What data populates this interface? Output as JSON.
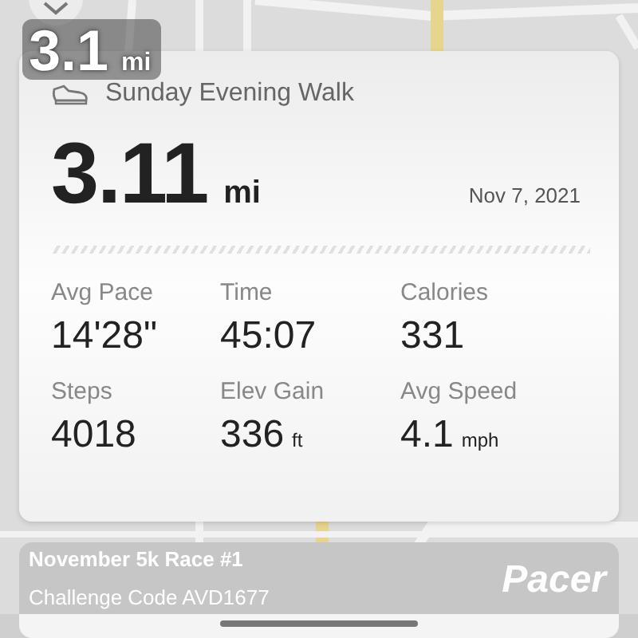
{
  "map_overlay": {
    "distance": "3.1",
    "unit": "mi"
  },
  "activity": {
    "title": "Sunday Evening Walk",
    "distance": "3.11",
    "unit": "mi",
    "date": "Nov 7, 2021",
    "stats": [
      {
        "label": "Avg Pace",
        "value": "14'28\""
      },
      {
        "label": "Time",
        "value": "45:07"
      },
      {
        "label": "Calories",
        "value": "331"
      },
      {
        "label": "Steps",
        "value": "4018"
      },
      {
        "label": "Elev Gain",
        "value": "336",
        "unit": "ft"
      },
      {
        "label": "Avg Speed",
        "value": "4.1",
        "unit": "mph"
      }
    ]
  },
  "banner": {
    "title": "November 5k Race #1",
    "code": "Challenge Code AVD1677",
    "brand": "Pacer"
  }
}
